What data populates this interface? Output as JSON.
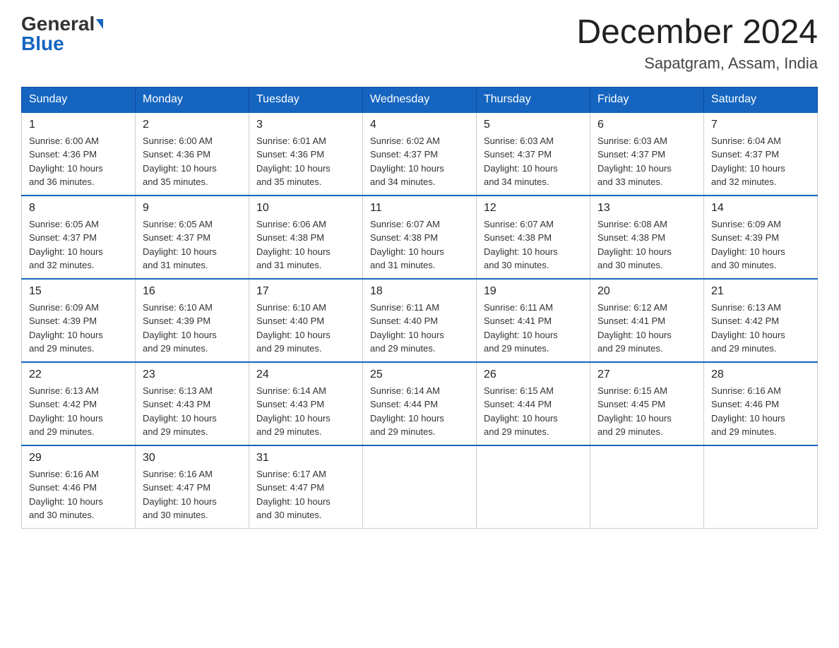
{
  "header": {
    "logo_general": "General",
    "logo_blue": "Blue",
    "title": "December 2024",
    "subtitle": "Sapatgram, Assam, India"
  },
  "columns": [
    "Sunday",
    "Monday",
    "Tuesday",
    "Wednesday",
    "Thursday",
    "Friday",
    "Saturday"
  ],
  "weeks": [
    [
      {
        "day": "1",
        "sunrise": "6:00 AM",
        "sunset": "4:36 PM",
        "daylight": "10 hours and 36 minutes."
      },
      {
        "day": "2",
        "sunrise": "6:00 AM",
        "sunset": "4:36 PM",
        "daylight": "10 hours and 35 minutes."
      },
      {
        "day": "3",
        "sunrise": "6:01 AM",
        "sunset": "4:36 PM",
        "daylight": "10 hours and 35 minutes."
      },
      {
        "day": "4",
        "sunrise": "6:02 AM",
        "sunset": "4:37 PM",
        "daylight": "10 hours and 34 minutes."
      },
      {
        "day": "5",
        "sunrise": "6:03 AM",
        "sunset": "4:37 PM",
        "daylight": "10 hours and 34 minutes."
      },
      {
        "day": "6",
        "sunrise": "6:03 AM",
        "sunset": "4:37 PM",
        "daylight": "10 hours and 33 minutes."
      },
      {
        "day": "7",
        "sunrise": "6:04 AM",
        "sunset": "4:37 PM",
        "daylight": "10 hours and 32 minutes."
      }
    ],
    [
      {
        "day": "8",
        "sunrise": "6:05 AM",
        "sunset": "4:37 PM",
        "daylight": "10 hours and 32 minutes."
      },
      {
        "day": "9",
        "sunrise": "6:05 AM",
        "sunset": "4:37 PM",
        "daylight": "10 hours and 31 minutes."
      },
      {
        "day": "10",
        "sunrise": "6:06 AM",
        "sunset": "4:38 PM",
        "daylight": "10 hours and 31 minutes."
      },
      {
        "day": "11",
        "sunrise": "6:07 AM",
        "sunset": "4:38 PM",
        "daylight": "10 hours and 31 minutes."
      },
      {
        "day": "12",
        "sunrise": "6:07 AM",
        "sunset": "4:38 PM",
        "daylight": "10 hours and 30 minutes."
      },
      {
        "day": "13",
        "sunrise": "6:08 AM",
        "sunset": "4:38 PM",
        "daylight": "10 hours and 30 minutes."
      },
      {
        "day": "14",
        "sunrise": "6:09 AM",
        "sunset": "4:39 PM",
        "daylight": "10 hours and 30 minutes."
      }
    ],
    [
      {
        "day": "15",
        "sunrise": "6:09 AM",
        "sunset": "4:39 PM",
        "daylight": "10 hours and 29 minutes."
      },
      {
        "day": "16",
        "sunrise": "6:10 AM",
        "sunset": "4:39 PM",
        "daylight": "10 hours and 29 minutes."
      },
      {
        "day": "17",
        "sunrise": "6:10 AM",
        "sunset": "4:40 PM",
        "daylight": "10 hours and 29 minutes."
      },
      {
        "day": "18",
        "sunrise": "6:11 AM",
        "sunset": "4:40 PM",
        "daylight": "10 hours and 29 minutes."
      },
      {
        "day": "19",
        "sunrise": "6:11 AM",
        "sunset": "4:41 PM",
        "daylight": "10 hours and 29 minutes."
      },
      {
        "day": "20",
        "sunrise": "6:12 AM",
        "sunset": "4:41 PM",
        "daylight": "10 hours and 29 minutes."
      },
      {
        "day": "21",
        "sunrise": "6:13 AM",
        "sunset": "4:42 PM",
        "daylight": "10 hours and 29 minutes."
      }
    ],
    [
      {
        "day": "22",
        "sunrise": "6:13 AM",
        "sunset": "4:42 PM",
        "daylight": "10 hours and 29 minutes."
      },
      {
        "day": "23",
        "sunrise": "6:13 AM",
        "sunset": "4:43 PM",
        "daylight": "10 hours and 29 minutes."
      },
      {
        "day": "24",
        "sunrise": "6:14 AM",
        "sunset": "4:43 PM",
        "daylight": "10 hours and 29 minutes."
      },
      {
        "day": "25",
        "sunrise": "6:14 AM",
        "sunset": "4:44 PM",
        "daylight": "10 hours and 29 minutes."
      },
      {
        "day": "26",
        "sunrise": "6:15 AM",
        "sunset": "4:44 PM",
        "daylight": "10 hours and 29 minutes."
      },
      {
        "day": "27",
        "sunrise": "6:15 AM",
        "sunset": "4:45 PM",
        "daylight": "10 hours and 29 minutes."
      },
      {
        "day": "28",
        "sunrise": "6:16 AM",
        "sunset": "4:46 PM",
        "daylight": "10 hours and 29 minutes."
      }
    ],
    [
      {
        "day": "29",
        "sunrise": "6:16 AM",
        "sunset": "4:46 PM",
        "daylight": "10 hours and 30 minutes."
      },
      {
        "day": "30",
        "sunrise": "6:16 AM",
        "sunset": "4:47 PM",
        "daylight": "10 hours and 30 minutes."
      },
      {
        "day": "31",
        "sunrise": "6:17 AM",
        "sunset": "4:47 PM",
        "daylight": "10 hours and 30 minutes."
      },
      null,
      null,
      null,
      null
    ]
  ],
  "labels": {
    "sunrise": "Sunrise:",
    "sunset": "Sunset:",
    "daylight": "Daylight:"
  }
}
